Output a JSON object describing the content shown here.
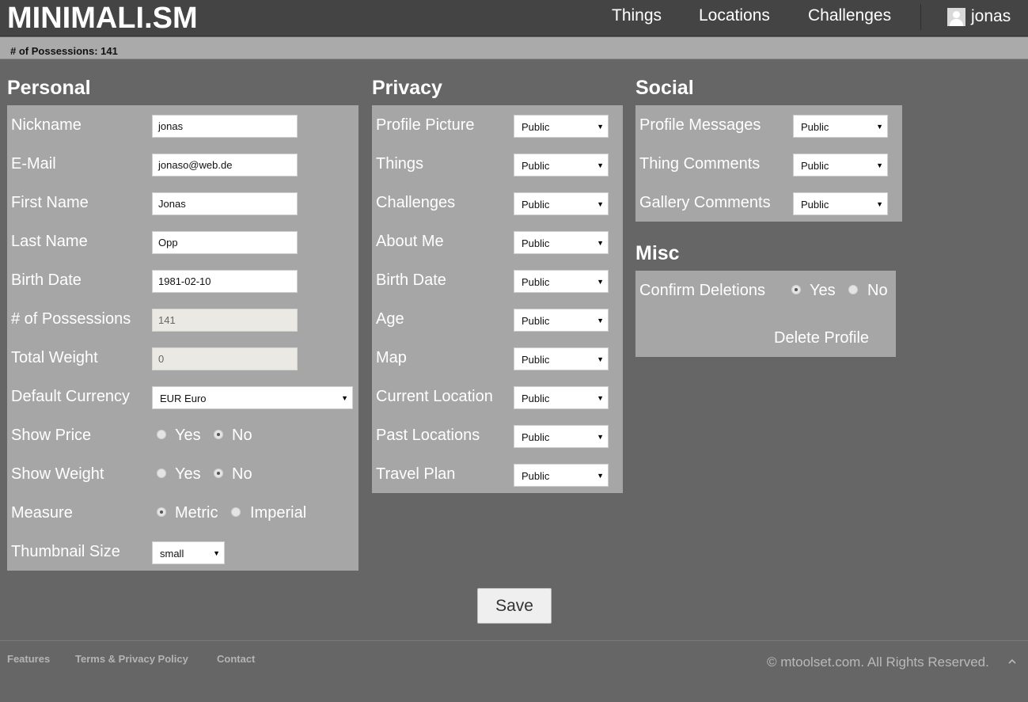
{
  "header": {
    "logo": "MINIMALI.SM",
    "nav": [
      "Things",
      "Locations",
      "Challenges"
    ],
    "user": "jonas"
  },
  "status": {
    "text": "# of Possessions: 141"
  },
  "personal": {
    "title": "Personal",
    "fields": [
      {
        "label": "Nickname",
        "value": "jonas"
      },
      {
        "label": "E-Mail",
        "value": "jonaso@web.de"
      },
      {
        "label": "First Name",
        "value": "Jonas"
      },
      {
        "label": "Last Name",
        "value": "Opp"
      },
      {
        "label": "Birth Date",
        "value": "1981-02-10"
      },
      {
        "label": "# of Possessions",
        "value": "141"
      },
      {
        "label": "Total Weight",
        "value": "0"
      }
    ],
    "currency": {
      "label": "Default Currency",
      "value": "EUR Euro"
    },
    "show_price": {
      "label": "Show Price",
      "yes": "Yes",
      "no": "No",
      "selected": "No"
    },
    "show_weight": {
      "label": "Show Weight",
      "yes": "Yes",
      "no": "No",
      "selected": "No"
    },
    "measure": {
      "label": "Measure",
      "metric": "Metric",
      "imperial": "Imperial",
      "selected": "Metric"
    },
    "thumbnail": {
      "label": "Thumbnail Size",
      "value": "small"
    }
  },
  "privacy": {
    "title": "Privacy",
    "items": [
      {
        "label": "Profile Picture",
        "value": "Public"
      },
      {
        "label": "Things",
        "value": "Public"
      },
      {
        "label": "Challenges",
        "value": "Public"
      },
      {
        "label": "About Me",
        "value": "Public"
      },
      {
        "label": "Birth Date",
        "value": "Public"
      },
      {
        "label": "Age",
        "value": "Public"
      },
      {
        "label": "Map",
        "value": "Public"
      },
      {
        "label": "Current Location",
        "value": "Public"
      },
      {
        "label": "Past Locations",
        "value": "Public"
      },
      {
        "label": "Travel Plan",
        "value": "Public"
      }
    ]
  },
  "social": {
    "title": "Social",
    "items": [
      {
        "label": "Profile Messages",
        "value": "Public"
      },
      {
        "label": "Thing Comments",
        "value": "Public"
      },
      {
        "label": "Gallery Comments",
        "value": "Public"
      }
    ]
  },
  "misc": {
    "title": "Misc",
    "confirm_label": "Confirm Deletions",
    "yes": "Yes",
    "no": "No",
    "selected": "Yes",
    "delete_label": "Delete Profile"
  },
  "save_label": "Save",
  "footer": {
    "links": [
      "Features",
      "Terms & Privacy Policy",
      "Contact"
    ],
    "copyright": "© mtoolset.com. All Rights Reserved."
  },
  "icons": {
    "avatar": "user-avatar-icon",
    "caret": "caret-down-icon",
    "scroll_up": "chevron-up-icon"
  }
}
